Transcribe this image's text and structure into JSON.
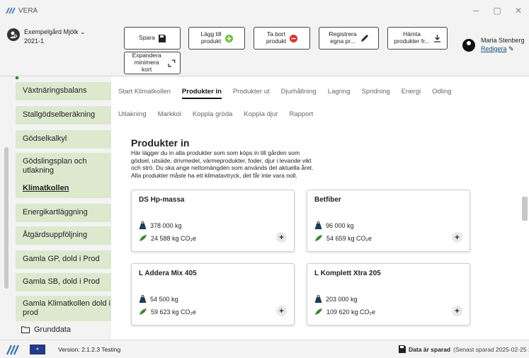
{
  "app": {
    "title": "VERA",
    "version_label": "Version:",
    "version": "2.1.2.3 Testing"
  },
  "window_controls": {
    "minimize": "─",
    "maximize": "▢",
    "close": "✕"
  },
  "farm": {
    "name": "Exempelgård Mjölk",
    "dropdown": "⌄",
    "year": "2021-1"
  },
  "toolbar": {
    "save": "Spara",
    "add_product": "Lägg till\nprodukt",
    "remove_product": "Ta bort\nprodukt",
    "register_own": "Registrera\negna pr...",
    "fetch_products": "Hämta\nprodukter fr...",
    "expand": "Expandera\nminimera kort"
  },
  "user": {
    "name": "Maria Stenberg",
    "edit": "Redigera"
  },
  "sidebar": {
    "items": [
      {
        "label": "Växtnäringsbalans"
      },
      {
        "label": "Stallgödselberäkning"
      },
      {
        "label": "Gödselkalkyl"
      },
      {
        "label": "Gödslingsplan och utlakning"
      },
      {
        "label": "Klimatkollen"
      },
      {
        "label": "Energikartläggning"
      },
      {
        "label": "Åtgärdsuppföljning"
      },
      {
        "label": "Gamla GP, dold i Prod"
      },
      {
        "label": "Gamla SB, dold i Prod"
      },
      {
        "label": "Gamla Klimatkollen dold i prod"
      }
    ],
    "active_index": 4,
    "folder": "Grunddata"
  },
  "tabs": {
    "row1": [
      "Start Klimatkollen",
      "Produkter in",
      "Produkter ut",
      "Djurhållning",
      "Lagring",
      "Spridning",
      "Energi",
      "Odling"
    ],
    "row2": [
      "Utlakning",
      "Markkol",
      "Koppla gröda",
      "Koppla djur",
      "Rapport"
    ],
    "active": "Produkter in"
  },
  "section": {
    "title": "Produkter in",
    "intro": [
      "Här lägger du in alla produkter som som köps in till gården som",
      "gödsel, utsäde, drivmedel, värmeprodukter, foder, djur i levande vikt",
      "och strö. Du ska ange nettomängden som används det aktuella året.",
      "Alla produkter måste ha ett klimatavtryck, det får inte vara noll."
    ]
  },
  "products": [
    {
      "name": "DS Hp-massa",
      "amount": "378 000 kg",
      "co2": "24 588 kg CO₂e"
    },
    {
      "name": "Betfiber",
      "amount": "96 000 kg",
      "co2": "54 659 kg CO₂e"
    },
    {
      "name": "L Addera Mix 405",
      "amount": "54 500 kg",
      "co2": "59 623 kg CO₂e"
    },
    {
      "name": "L Komplett Xtra 205",
      "amount": "203 000 kg",
      "co2": "109 620 kg CO₂e"
    }
  ],
  "status": {
    "saved": "Data är sparad",
    "last_saved": "(Senast sparad 2025-02-25 10:27)"
  },
  "colors": {
    "sidebar_item": "#dce9cf",
    "accent_green": "#3a8a2a",
    "remove_red": "#d9342b",
    "eu_blue": "#1e3a9e"
  }
}
